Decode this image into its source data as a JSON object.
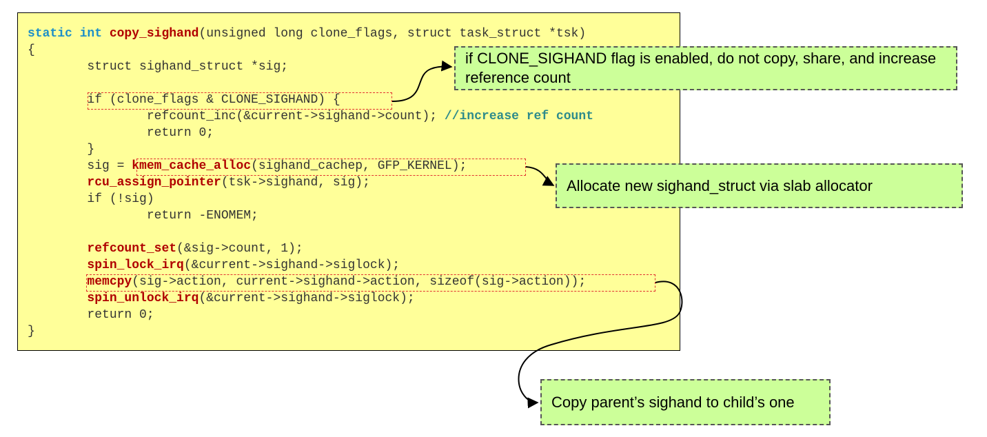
{
  "code": {
    "lines": [
      [
        {
          "t": "static int ",
          "c": "kw"
        },
        {
          "t": "copy_sighand",
          "c": "fn"
        },
        {
          "t": "(unsigned long clone_flags, struct task_struct *tsk)"
        }
      ],
      [
        {
          "t": "{"
        }
      ],
      [
        {
          "t": "        struct sighand_struct *sig;"
        }
      ],
      [
        {
          "t": ""
        }
      ],
      [
        {
          "t": "        if (clone_flags & CLONE_SIGHAND) {"
        }
      ],
      [
        {
          "t": "                refcount_inc(&current->sighand->count); "
        },
        {
          "t": "//increase ref count",
          "c": "cm"
        }
      ],
      [
        {
          "t": "                return 0;"
        }
      ],
      [
        {
          "t": "        }"
        }
      ],
      [
        {
          "t": "        sig = "
        },
        {
          "t": "kmem_cache_alloc",
          "c": "fn"
        },
        {
          "t": "(sighand_cachep, GFP_KERNEL);"
        }
      ],
      [
        {
          "t": "        "
        },
        {
          "t": "rcu_assign_pointer",
          "c": "fn"
        },
        {
          "t": "(tsk->sighand, sig);"
        }
      ],
      [
        {
          "t": "        if (!sig)"
        }
      ],
      [
        {
          "t": "                return -ENOMEM;"
        }
      ],
      [
        {
          "t": ""
        }
      ],
      [
        {
          "t": "        "
        },
        {
          "t": "refcount_set",
          "c": "fn"
        },
        {
          "t": "(&sig->count, 1);"
        }
      ],
      [
        {
          "t": "        "
        },
        {
          "t": "spin_lock_irq",
          "c": "fn"
        },
        {
          "t": "(&current->sighand->siglock);"
        }
      ],
      [
        {
          "t": "        "
        },
        {
          "t": "memcpy",
          "c": "fn"
        },
        {
          "t": "(sig->action, current->sighand->action, sizeof(sig->action));"
        }
      ],
      [
        {
          "t": "        "
        },
        {
          "t": "spin_unlock_irq",
          "c": "fn"
        },
        {
          "t": "(&current->sighand->siglock);"
        }
      ],
      [
        {
          "t": "        return 0;"
        }
      ],
      [
        {
          "t": "}"
        }
      ]
    ]
  },
  "notes": {
    "share": "if CLONE_SIGHAND flag is enabled, do not copy, share, and increase reference count",
    "alloc": "Allocate new sighand_struct via slab allocator",
    "copy": "Copy parent’s sighand to child’s one"
  },
  "colors": {
    "code_bg": "#ffff99",
    "note_bg": "#ccff99",
    "keyword": "#1e90c8",
    "function": "#b00000",
    "comment": "#2e8b8b",
    "highlight_border": "#e03030"
  }
}
